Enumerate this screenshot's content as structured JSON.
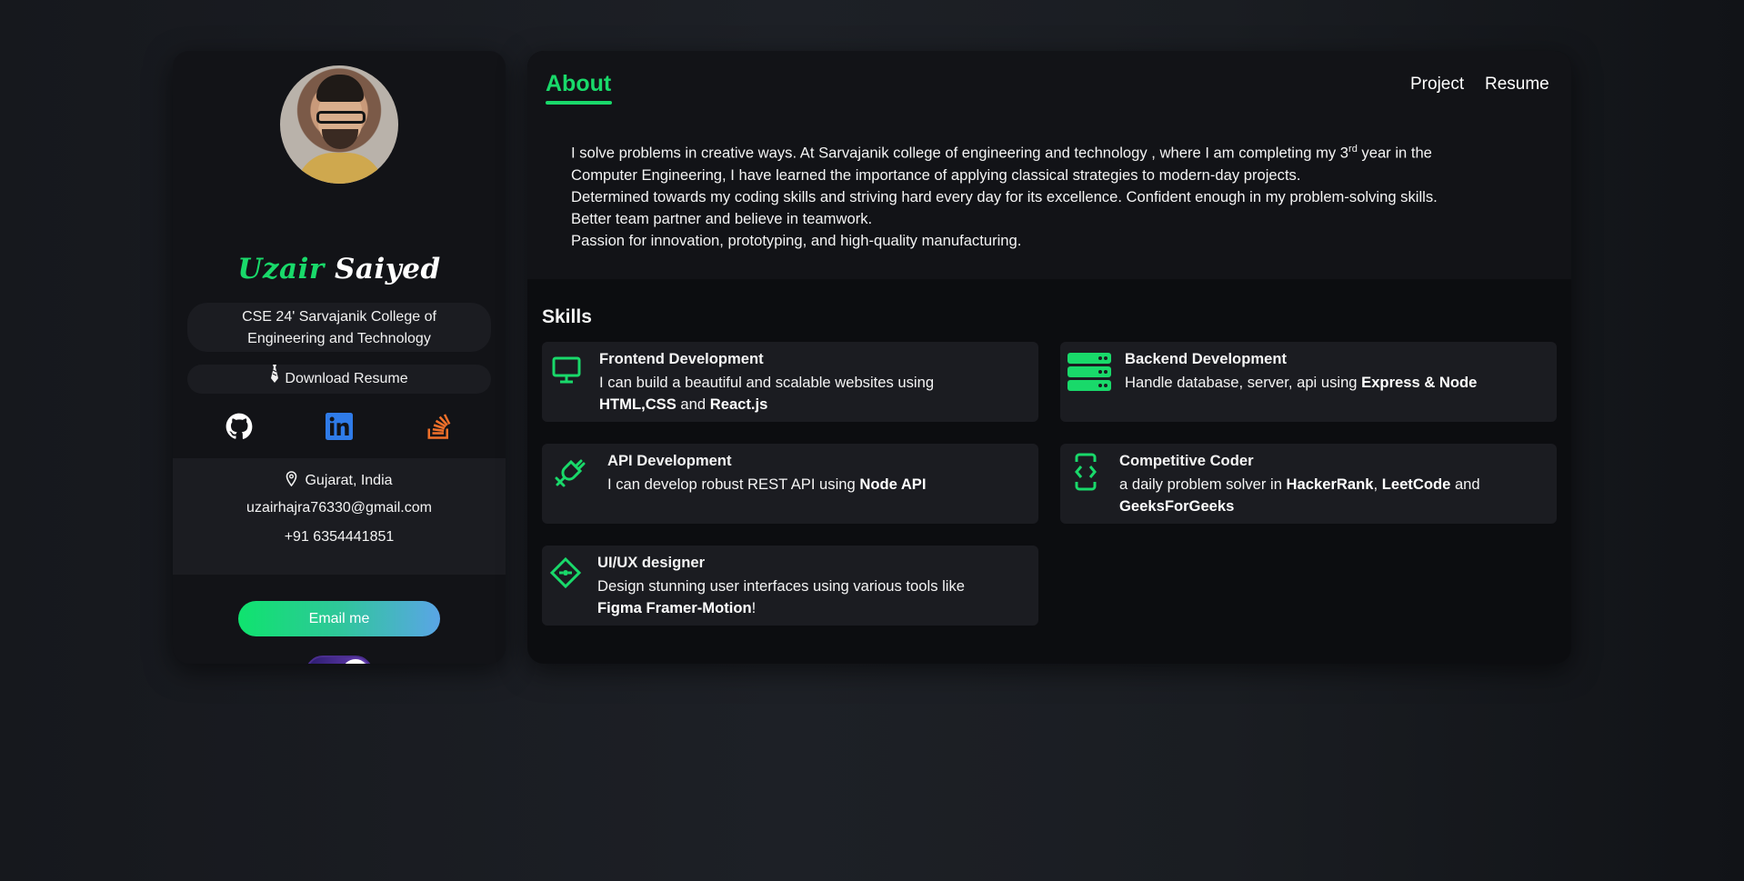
{
  "profile": {
    "first_name": "Uzair",
    "last_name": "Saiyed",
    "college_line1": "CSE 24' Sarvajanik College of",
    "college_line2": "Engineering and Technology",
    "download_resume": "Download Resume",
    "socials": [
      {
        "name": "github-icon"
      },
      {
        "name": "linkedin-icon"
      },
      {
        "name": "stackoverflow-icon"
      }
    ],
    "location": "Gujarat, India",
    "email": "uzairhajra76330@gmail.com",
    "phone": "+91 6354441851",
    "email_button": "Email me"
  },
  "nav": {
    "about": "About",
    "project": "Project",
    "resume": "Resume"
  },
  "about": {
    "line1_pre": "I solve problems in creative ways. At Sarvajanik college of engineering and technology , where I am completing my 3",
    "line1_sup": "rd",
    "line1_post": " year in the",
    "line2": "Computer Engineering, I have learned the importance of applying classical strategies to modern-day projects.",
    "line3": "Determined towards my coding skills and striving hard every day for its excellence. Confident enough in my problem-solving skills.",
    "line4": "Better team partner and believe in teamwork.",
    "line5": "Passion for innovation, prototyping, and high-quality manufacturing."
  },
  "skills": {
    "title": "Skills",
    "items": [
      {
        "icon": "monitor-icon",
        "title": "Frontend Development",
        "desc_a": "I can build a beautiful and scalable websites using",
        "bold1": "HTML,CSS",
        "mid": " and ",
        "bold2": "React.js"
      },
      {
        "icon": "server-icon",
        "title": "Backend Development",
        "desc_a": "Handle database, server, api using ",
        "bold1": "Express & Node"
      },
      {
        "icon": "plug-icon",
        "title": "API Development",
        "desc_a": "I can develop robust REST API using ",
        "bold1": "Node API"
      },
      {
        "icon": "code-icon",
        "title": "Competitive Coder",
        "desc_a": "a daily problem solver in ",
        "bold1": "HackerRank",
        "sep": ", ",
        "bold2": "LeetCode",
        "tail": " and",
        "bold3": "GeeksForGeeks"
      },
      {
        "icon": "design-icon",
        "title": "UI/UX designer",
        "desc_a": "Design stunning user interfaces using various tools like",
        "bold1": "Figma Framer-Motion",
        "tail": "!"
      }
    ]
  },
  "colors": {
    "accent_green": "#19d96a",
    "background": "#16181d",
    "card": "#1b1c21"
  }
}
